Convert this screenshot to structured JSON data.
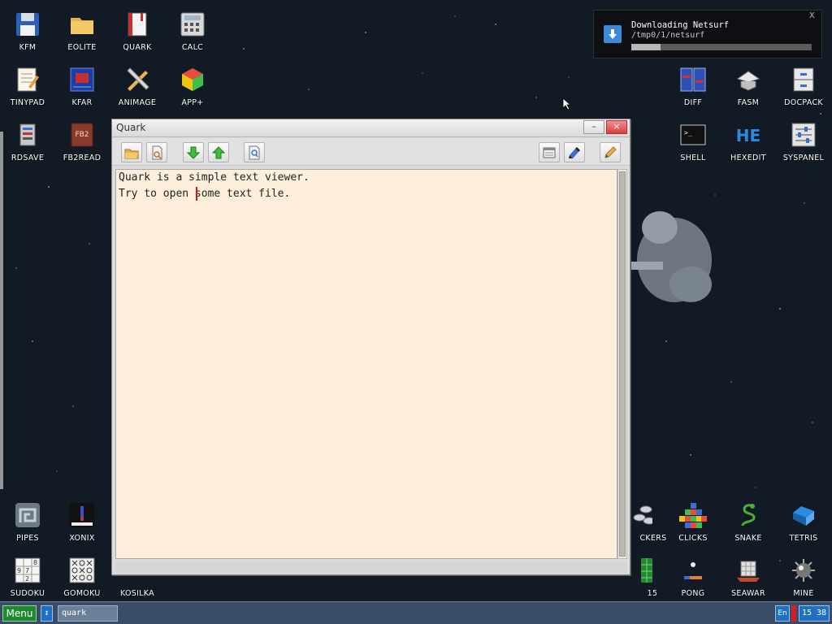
{
  "desktop": {
    "icons": [
      {
        "label": "KFM"
      },
      {
        "label": "EOLITE"
      },
      {
        "label": "QUARK"
      },
      {
        "label": "CALC"
      },
      {
        "label": "TINYPAD"
      },
      {
        "label": "KFAR"
      },
      {
        "label": "ANIMAGE"
      },
      {
        "label": "APP+"
      },
      {
        "label": "RDSAVE"
      },
      {
        "label": "FB2READ"
      },
      {
        "label": "DIFF"
      },
      {
        "label": "FASM"
      },
      {
        "label": "DOCPACK"
      },
      {
        "label": "SHELL"
      },
      {
        "label": "HEXEDIT"
      },
      {
        "label": "SYSPANEL"
      },
      {
        "label": "PIPES"
      },
      {
        "label": "XONIX"
      },
      {
        "label": "SUDOKU"
      },
      {
        "label": "GOMOKU"
      },
      {
        "label": "KOSILKA"
      },
      {
        "label": "CKERS"
      },
      {
        "label": "CLICKS"
      },
      {
        "label": "SNAKE"
      },
      {
        "label": "TETRIS"
      },
      {
        "label": "15"
      },
      {
        "label": "PONG"
      },
      {
        "label": "SEAWAR"
      },
      {
        "label": "MINE"
      }
    ]
  },
  "notification": {
    "title": "Downloading Netsurf",
    "path": "/tmp0/1/netsurf",
    "progress": 0.16,
    "close": "x"
  },
  "window": {
    "title": "Quark",
    "minimize": "–",
    "close": "×",
    "toolbar": [
      "folder-open-icon",
      "search-file-icon",
      "arrow-down-icon",
      "arrow-up-icon",
      "find-icon",
      "font-settings-icon",
      "encoding-icon",
      "edit-pencil-icon"
    ],
    "lines": [
      "Quark is a simple text viewer.",
      "Try to open some text file."
    ]
  },
  "taskbar": {
    "menu_label": "Menu",
    "switch_glyph": "↕",
    "task": "quark",
    "lang": "En",
    "clock": "15 38"
  },
  "colors": {
    "desktop_bg": "#121a26",
    "text_bg": "#fdefd9",
    "taskbar_bg": "#3b4d66",
    "menu_green": "#1e8a2e",
    "accent_blue": "#1f6fc4",
    "close_red": "#d64040"
  }
}
